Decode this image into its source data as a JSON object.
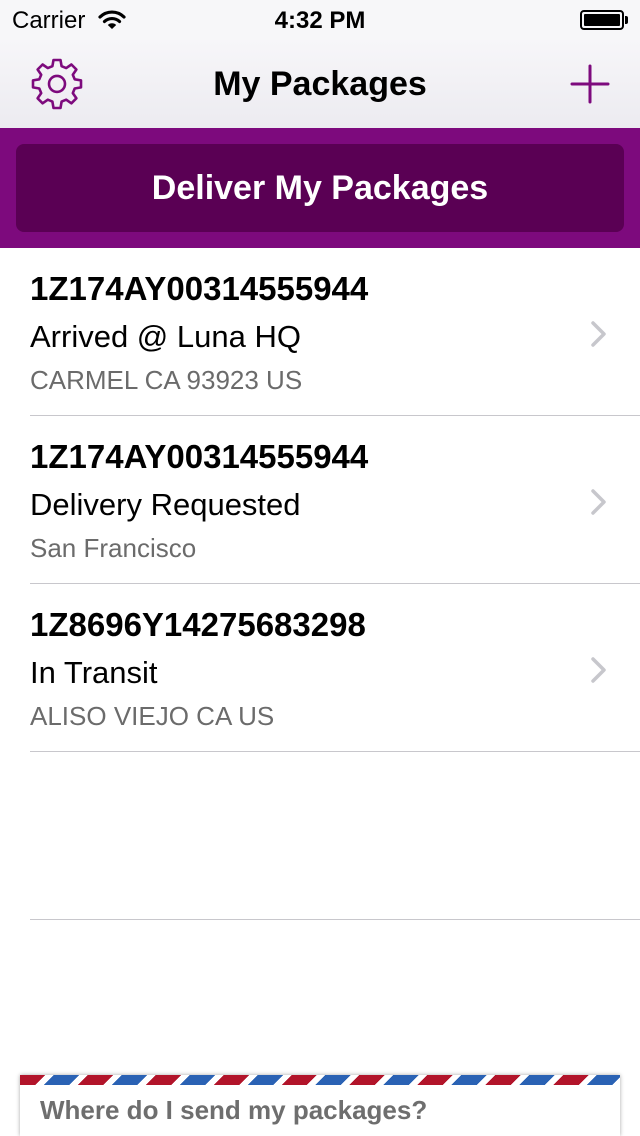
{
  "status_bar": {
    "carrier": "Carrier",
    "time": "4:32 PM"
  },
  "nav": {
    "title": "My Packages",
    "left_icon": "gear-icon",
    "right_icon": "plus-icon"
  },
  "banner": {
    "button_label": "Deliver My Packages"
  },
  "packages": [
    {
      "tracking": "1Z174AY00314555944",
      "status": "Arrived @ Luna HQ",
      "location": "CARMEL CA 93923 US"
    },
    {
      "tracking": "1Z174AY00314555944",
      "status": "Delivery Requested",
      "location": "San Francisco"
    },
    {
      "tracking": "1Z8696Y14275683298",
      "status": "In Transit",
      "location": "ALISO VIEJO CA US"
    }
  ],
  "footer": {
    "prompt": "Where do I send my packages?"
  },
  "colors": {
    "accent": "#7d0a7d",
    "button_bg": "#5a0054",
    "stripe_red": "#b2142a",
    "stripe_blue": "#2a62b4"
  }
}
